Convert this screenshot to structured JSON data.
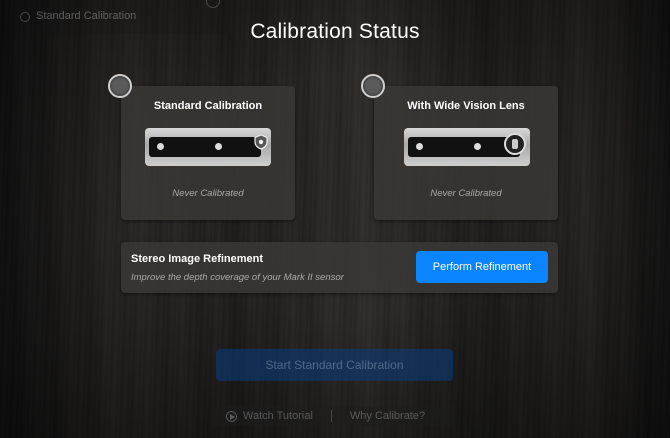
{
  "background_menu": {
    "item_label": "Standard Calibration"
  },
  "title": "Calibration Status",
  "cards": [
    {
      "title": "Standard Calibration",
      "status": "Never Calibrated"
    },
    {
      "title": "With Wide Vision Lens",
      "status": "Never Calibrated"
    }
  ],
  "refinement": {
    "title": "Stereo Image Refinement",
    "subtitle": "Improve the depth coverage of your Mark II sensor",
    "button_label": "Perform Refinement"
  },
  "footer": {
    "start_label": "Start Standard Calibration",
    "tutorial_label": "Watch Tutorial",
    "why_label": "Why Calibrate?"
  },
  "colors": {
    "accent": "#0a84ff",
    "card_bg": "#3a3836"
  },
  "icons": [
    "shield-icon",
    "wide-lens-icon",
    "play-icon"
  ]
}
